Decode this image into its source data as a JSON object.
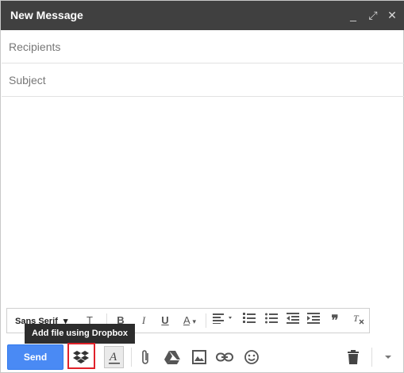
{
  "window": {
    "title": "New Message",
    "controls": {
      "minimize": "_",
      "popout": "⤢",
      "close": "✕"
    }
  },
  "fields": {
    "recipients_placeholder": "Recipients",
    "subject_placeholder": "Subject"
  },
  "format_toolbar": {
    "font_name": "Sans Serif",
    "font_caret": "▾",
    "size_icon": "T",
    "bold": "B",
    "italic": "I",
    "underline": "U",
    "text_color": "A",
    "quote": "❞"
  },
  "tooltip": "Add file using Dropbox",
  "bottom": {
    "send_label": "Send",
    "icons": [
      "dropbox-icon",
      "formatting-options-icon",
      "attach-icon",
      "google-drive-icon",
      "insert-photo-icon",
      "insert-link-icon",
      "emoji-icon",
      "discard-icon",
      "more-options-icon"
    ]
  },
  "colors": {
    "titlebar": "#404040",
    "send": "#4a8af4",
    "highlight_box": "#e0212a"
  }
}
